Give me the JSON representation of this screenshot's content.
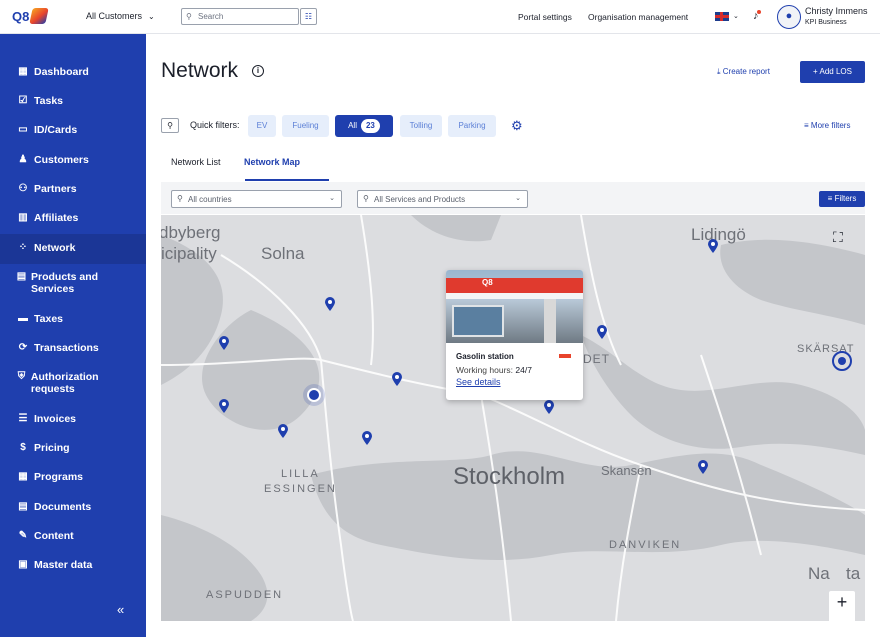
{
  "app": {
    "logo_text": "Q8",
    "customer_switch": "All Customers",
    "search_placeholder": "Search",
    "portal_settings": "Portal settings",
    "org_management": "Organisation management",
    "user_name": "Christy Immens",
    "user_role": "KPI Business",
    "colors": {
      "brand": "#1f3fae",
      "accent_pin": "#f6a623"
    }
  },
  "sidebar": {
    "items": [
      {
        "label": "Dashboard",
        "icon": "dashboard-icon",
        "glyph": "▦"
      },
      {
        "label": "Tasks",
        "icon": "tasks-icon",
        "glyph": "☑"
      },
      {
        "label": "ID/Cards",
        "icon": "cards-icon",
        "glyph": "▭"
      },
      {
        "label": "Customers",
        "icon": "customers-icon",
        "glyph": "♟"
      },
      {
        "label": "Partners",
        "icon": "partners-icon",
        "glyph": "⚇"
      },
      {
        "label": "Affiliates",
        "icon": "affiliates-icon",
        "glyph": "▥"
      },
      {
        "label": "Network",
        "icon": "network-icon",
        "glyph": "⁘"
      },
      {
        "label": "Products and Services",
        "icon": "products-icon",
        "glyph": "▤"
      },
      {
        "label": "Taxes",
        "icon": "taxes-icon",
        "glyph": "▬"
      },
      {
        "label": "Transactions",
        "icon": "transactions-icon",
        "glyph": "⟳"
      },
      {
        "label": "Authorization requests",
        "icon": "authorization-icon",
        "glyph": "⛨"
      },
      {
        "label": "Invoices",
        "icon": "invoices-icon",
        "glyph": "☰"
      },
      {
        "label": "Pricing",
        "icon": "pricing-icon",
        "glyph": "$"
      },
      {
        "label": "Programs",
        "icon": "programs-icon",
        "glyph": "▦"
      },
      {
        "label": "Documents",
        "icon": "documents-icon",
        "glyph": "▤"
      },
      {
        "label": "Content",
        "icon": "content-icon",
        "glyph": "✎"
      },
      {
        "label": "Master data",
        "icon": "master-data-icon",
        "glyph": "▣"
      }
    ],
    "active": "Network",
    "collapse_label": "«"
  },
  "page": {
    "title": "Network",
    "create_report": "Create report",
    "add_los": "+ Add LOS",
    "quick_filters_label": "Quick filters:",
    "chips": [
      {
        "label": "EV"
      },
      {
        "label": "Fueling"
      },
      {
        "label": "All",
        "count": "23"
      },
      {
        "label": "Tolling"
      },
      {
        "label": "Parking"
      }
    ],
    "more_filters": "More filters",
    "tabs": [
      {
        "label": "Network List"
      },
      {
        "label": "Network Map"
      }
    ],
    "active_tab": "Network Map",
    "countries_placeholder": "All countries",
    "services_placeholder": "All Services and Products",
    "filters_button": "Filters"
  },
  "map": {
    "labels": [
      "dbyberg",
      "icipality",
      "Solna",
      "Lidingö",
      "SKÄRSAT",
      "DET",
      "LILLA",
      "ESSINGEN",
      "Stockholm",
      "Skansen",
      "DANVIKEN",
      "Na",
      "ta",
      "ASPUDDEN"
    ],
    "popup": {
      "brand_text": "Q8",
      "title": "Gasolin station",
      "hours_label": "Working hours:",
      "hours_value": "24/7",
      "link": "See details"
    },
    "zoom_in": "+",
    "zoom_out": "−"
  }
}
